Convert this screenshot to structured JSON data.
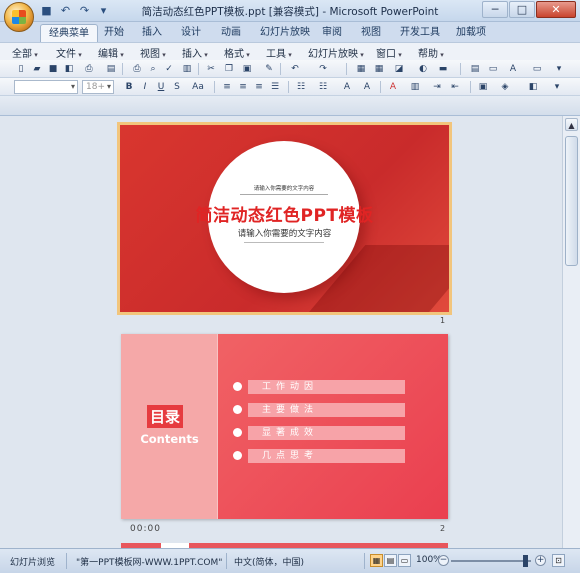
{
  "window": {
    "title": "简洁动态红色PPT模板.ppt [兼容模式] - Microsoft PowerPoint"
  },
  "quick_access": [
    "save-icon",
    "undo-icon",
    "redo-icon",
    "customize-icon"
  ],
  "window_controls": {
    "minimize": "─",
    "maximize": "□",
    "close": "✕"
  },
  "ribbon_tabs": [
    {
      "label": "经典菜单",
      "active": true
    },
    {
      "label": "开始"
    },
    {
      "label": "插入"
    },
    {
      "label": "设计"
    },
    {
      "label": "动画"
    },
    {
      "label": "幻灯片放映"
    },
    {
      "label": "审阅"
    },
    {
      "label": "视图"
    },
    {
      "label": "开发工具"
    },
    {
      "label": "加载项"
    }
  ],
  "menus": [
    "全部",
    "文件",
    "编辑",
    "视图",
    "插入",
    "格式",
    "工具",
    "幻灯片放映",
    "窗口",
    "帮助"
  ],
  "toolbar": {
    "font_size_placeholder": "18+",
    "bold": "B",
    "italic": "I",
    "underline": "U",
    "strike": "S",
    "shadow": "Aa"
  },
  "slides": [
    {
      "number": "1",
      "top_text": "请输入你需要的文字内容",
      "title": "简洁动态红色PPT模板",
      "subtitle": "请输入你需要的文字内容"
    },
    {
      "number": "2",
      "heading": "目录",
      "heading_en": "Contents",
      "items": [
        "工作动因",
        "主要做法",
        "显著成效",
        "几点思考"
      ],
      "time": "00:00"
    }
  ],
  "status": {
    "view": "幻灯片浏览",
    "theme": "\"第一PPT模板网-WWW.1PPT.COM\"",
    "language": "中文(简体，中国)",
    "zoom": "100%"
  },
  "colors": {
    "slide1_bg": "#d9362f",
    "title_red": "#e02424",
    "slide2_bg": "#ea3f4f",
    "slide2_panel": "#f5a8a8",
    "selection_border": "#f2c57c"
  }
}
